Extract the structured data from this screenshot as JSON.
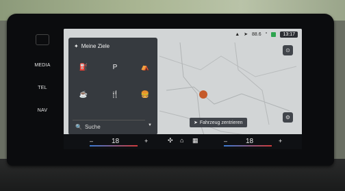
{
  "softkeys": [
    "MEDIA",
    "TEL",
    "NAV"
  ],
  "status": {
    "temp": "88.6",
    "time": "13:17",
    "unit": "°"
  },
  "panel": {
    "title": "Meine Ziele",
    "search": "Suche"
  },
  "map": {
    "center_button": "Fahrzeug zentrieren"
  },
  "climate": {
    "left_temp": "18",
    "right_temp": "18",
    "minus": "–",
    "plus": "+"
  },
  "colors": {
    "panel": "#2c3036",
    "accent": "#2ea44f"
  }
}
